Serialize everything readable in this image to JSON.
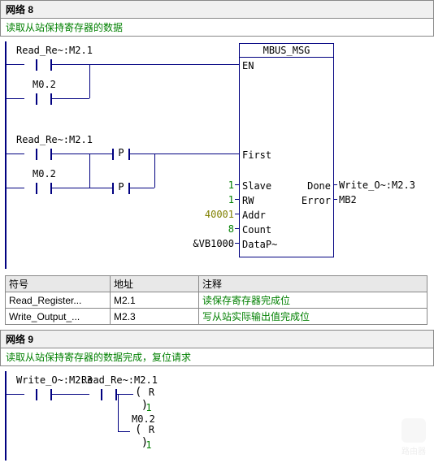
{
  "network8": {
    "title": "网络 8",
    "comment": "读取从站保持寄存器的数据",
    "contacts": {
      "c1_label": "Read_Re~:M2.1",
      "c2_label": "M0.2",
      "c3_label": "Read_Re~:M2.1",
      "c4_label": "M0.2",
      "p_label": "P"
    },
    "fb": {
      "name": "MBUS_MSG",
      "en": "EN",
      "first": "First",
      "slave": "Slave",
      "rw": "RW",
      "addr": "Addr",
      "count": "Count",
      "datap": "DataP~",
      "done": "Done",
      "error": "Error",
      "val_slave": "1",
      "val_rw": "1",
      "val_addr": "40001",
      "val_count": "8",
      "val_datap": "&VB1000",
      "out_done": "Write_O~:M2.3",
      "out_error": "MB2"
    }
  },
  "symtab": {
    "h_symbol": "符号",
    "h_addr": "地址",
    "h_comment": "注释",
    "rows": [
      {
        "sym": "Read_Register...",
        "addr": "M2.1",
        "cm": "读保存寄存器完成位"
      },
      {
        "sym": "Write_Output_...",
        "addr": "M2.3",
        "cm": "写从站实际输出值完成位"
      }
    ]
  },
  "network9": {
    "title": "网络 9",
    "comment": "读取从站保持寄存器的数据完成，复位请求",
    "c1_label": "Write_O~:M2.3",
    "c2_label": "Read_Re~:M2.1",
    "coil1_type": "R",
    "coil1_count": "1",
    "coil2_label": "M0.2",
    "coil2_type": "R",
    "coil2_count": "1"
  },
  "watermark": "路由器"
}
